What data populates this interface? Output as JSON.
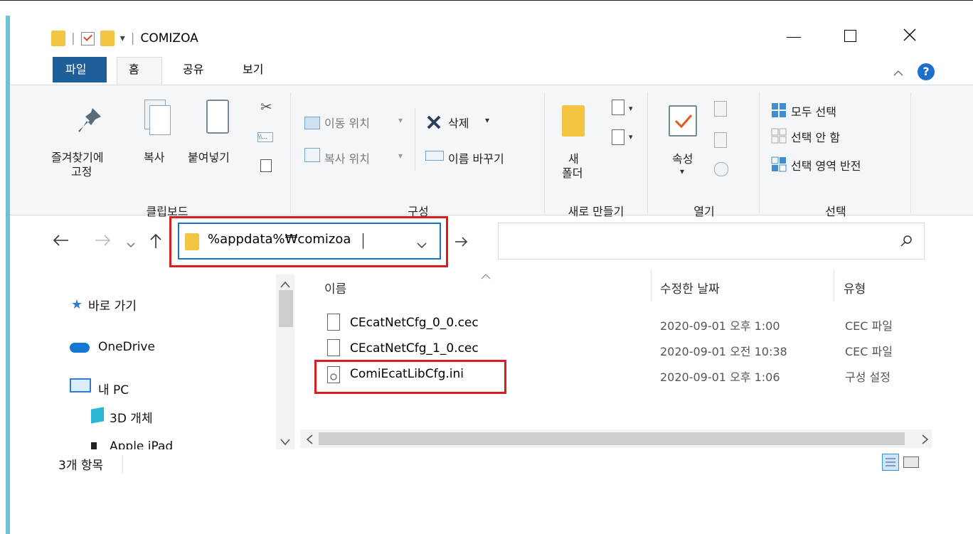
{
  "window": {
    "title": "COMIZOA",
    "qat_separator": "|",
    "qat_dropdown": "▾"
  },
  "tabs": [
    "파일",
    "홈",
    "공유",
    "보기"
  ],
  "ribbon": {
    "clipboard": {
      "pin_label_line1": "즐겨찾기에",
      "pin_label_line2": "고정",
      "copy_label": "복사",
      "paste_label": "붙여넣기",
      "group_label": "클립보드"
    },
    "organize": {
      "move_to": "이동 위치",
      "copy_to": "복사 위치",
      "delete": "삭제",
      "rename": "이름 바꾸기",
      "group_label": "구성"
    },
    "new": {
      "new_folder_line1": "새",
      "new_folder_line2": "폴더",
      "group_label": "새로 만들기"
    },
    "open": {
      "properties": "속성",
      "group_label": "열기"
    },
    "select": {
      "select_all": "모두 선택",
      "select_none": "선택 안 함",
      "invert": "선택 영역 반전",
      "group_label": "선택"
    }
  },
  "address": {
    "path": "%appdata%₩comizoa"
  },
  "columns": {
    "name": "이름",
    "date": "수정한 날짜",
    "type": "유형"
  },
  "nav": {
    "quick_access": "바로 가기",
    "onedrive": "OneDrive",
    "this_pc": "내 PC",
    "objects3d": "3D 개체",
    "apple": "Apple iPad"
  },
  "files": [
    {
      "name": "CEcatNetCfg_0_0.cec",
      "date": "2020-09-01 오후 1:00",
      "type": "CEC 파일"
    },
    {
      "name": "CEcatNetCfg_1_0.cec",
      "date": "2020-09-01 오전 10:38",
      "type": "CEC 파일"
    },
    {
      "name": "ComiEcatLibCfg.ini",
      "date": "2020-09-01 오후 1:06",
      "type": "구성 설정"
    }
  ],
  "status": {
    "item_count": "3개 항목"
  },
  "colors": {
    "file_tab": "#1f5f99",
    "highlight": "#d81f1f",
    "folder": "#f4c542",
    "accent_bar": "#6dc1d6"
  }
}
